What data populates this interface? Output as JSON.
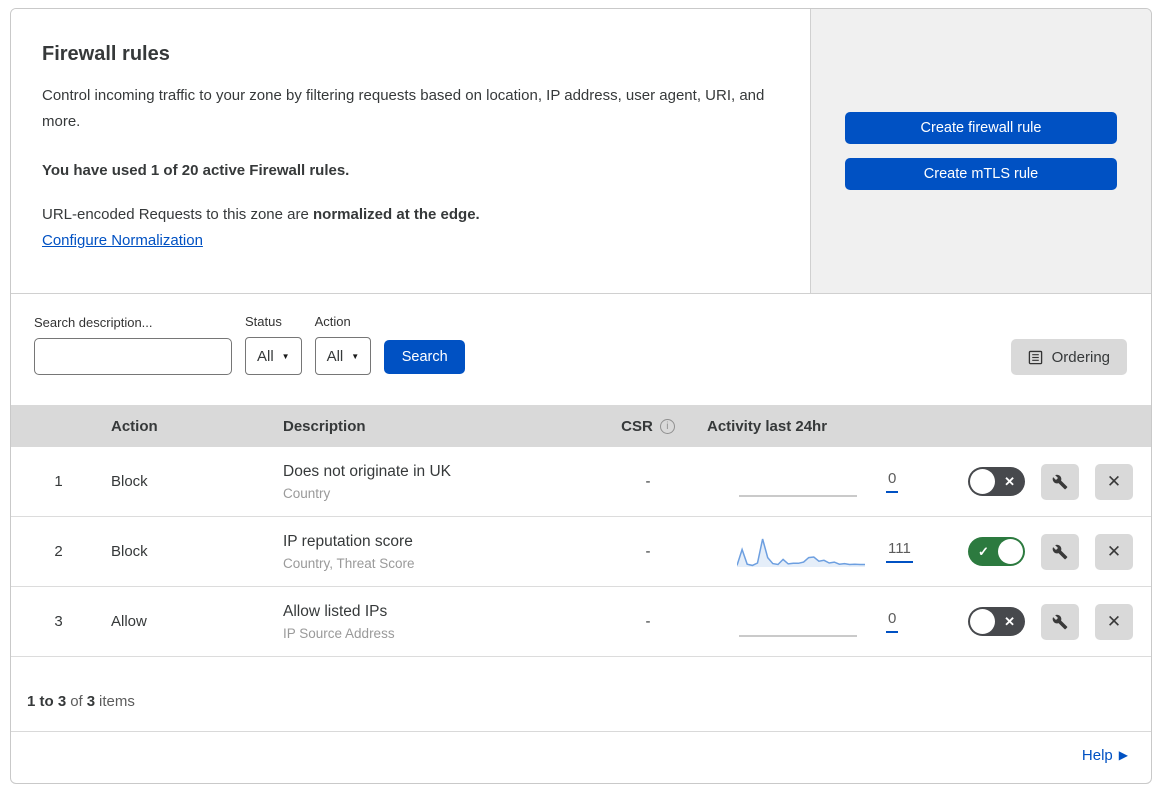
{
  "header": {
    "title": "Firewall rules",
    "description": "Control incoming traffic to your zone by filtering requests based on location, IP address, user agent, URI, and more.",
    "usage_note": "You have used 1 of 20 active Firewall rules.",
    "normalization_prefix": "URL-encoded Requests to this zone are ",
    "normalization_bold": "normalized at the edge.",
    "normalization_link": "Configure Normalization"
  },
  "actions_panel": {
    "create_firewall_rule": "Create firewall rule",
    "create_mtls_rule": "Create mTLS rule"
  },
  "filters": {
    "search_label": "Search description...",
    "status_label": "Status",
    "status_value": "All",
    "action_label": "Action",
    "action_value": "All",
    "search_button": "Search",
    "ordering_button": "Ordering"
  },
  "table": {
    "headers": {
      "action": "Action",
      "description": "Description",
      "csr": "CSR",
      "activity": "Activity last 24hr"
    },
    "rows": [
      {
        "index": "1",
        "action": "Block",
        "description": "Does not originate in UK",
        "fields": "Country",
        "csr": "-",
        "activity_count": "0",
        "enabled": false,
        "sparkline": []
      },
      {
        "index": "2",
        "action": "Block",
        "description": "IP reputation score",
        "fields": "Country, Threat Score",
        "csr": "-",
        "activity_count": "111",
        "enabled": true,
        "sparkline": [
          2,
          55,
          6,
          2,
          10,
          90,
          28,
          8,
          5,
          22,
          7,
          9,
          9,
          13,
          28,
          30,
          16,
          19,
          10,
          13,
          6,
          8,
          5,
          6,
          5,
          5
        ]
      },
      {
        "index": "3",
        "action": "Allow",
        "description": "Allow listed IPs",
        "fields": "IP Source Address",
        "csr": "-",
        "activity_count": "0",
        "enabled": false,
        "sparkline": []
      }
    ]
  },
  "footer": {
    "range": "1 to 3",
    "of": "of",
    "total": "3",
    "items_word": "items",
    "help": "Help"
  },
  "icons": {
    "check": "✓",
    "x": "✕",
    "caret_down": "▼",
    "info": "i",
    "arrow_right": "▶"
  },
  "colors": {
    "accent_blue": "#0051c3",
    "toggle_on_green": "#2c7a3f",
    "toggle_off_gray": "#47494d",
    "sparkline_blue": "#6d9fe0",
    "table_header_gray": "#d9d9d9",
    "side_panel_gray": "#f0f0f0"
  }
}
